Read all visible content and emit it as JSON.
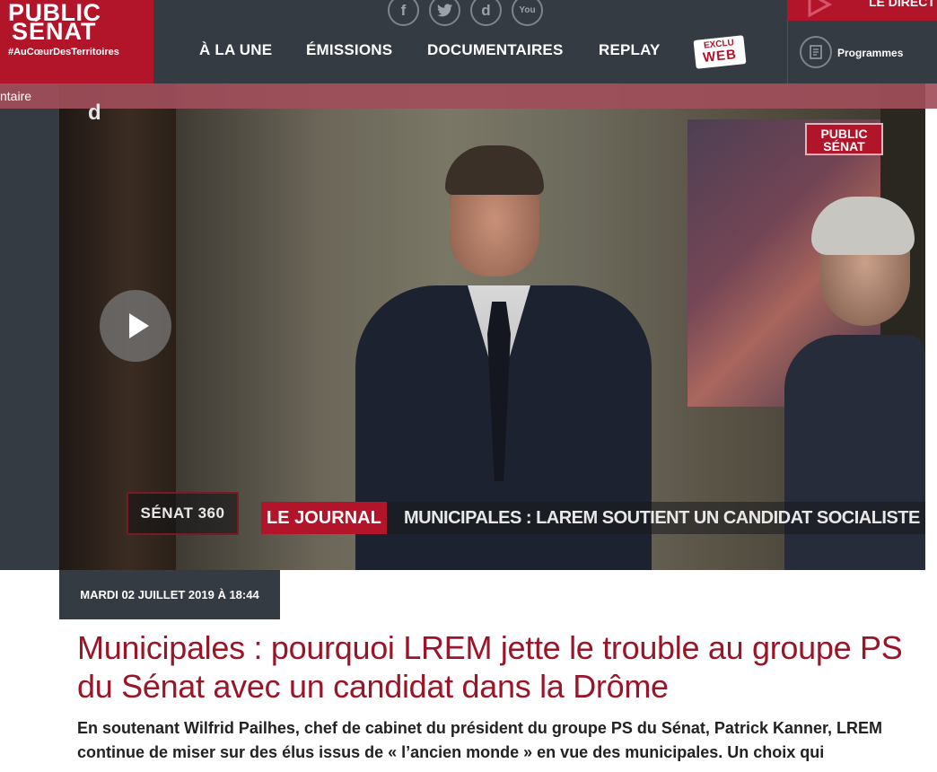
{
  "header": {
    "logo_line1": "PUBLIC",
    "logo_line2": "SÉNAT",
    "logo_tagline": "#AuCœurDesTerritoires",
    "social": [
      {
        "icon": "facebook-icon",
        "glyph": "f"
      },
      {
        "icon": "twitter-icon",
        "glyph": "✦"
      },
      {
        "icon": "dailymotion-icon",
        "glyph": "d"
      },
      {
        "icon": "youtube-icon",
        "glyph": "You"
      }
    ],
    "nav": [
      "À LA UNE",
      "ÉMISSIONS",
      "DOCUMENTAIRES",
      "REPLAY"
    ],
    "exclu_line1": "EXCLU",
    "exclu_line2": "WEB",
    "programmes_label": "Programmes",
    "live_label": "LE DIRECT"
  },
  "strip_text": "ntaire",
  "video": {
    "overlay_letter": "d",
    "channel_logo_line1": "PUBLIC",
    "channel_logo_line2": "SÉNAT",
    "show_badge": "SÉNAT 360",
    "ticker_tag": "LE JOURNAL",
    "ticker_text": "MUNICIPALES : LAREM SOUTIENT UN CANDIDAT SOCIALISTE"
  },
  "article": {
    "date": "MARDI 02 JUILLET 2019 À 18:44",
    "headline": "Municipales : pourquoi LREM jette le trouble au groupe PS du Sénat avec un candidat dans la Drôme",
    "lead": "En soutenant Wilfrid Pailhes, chef de cabinet du président du groupe PS du Sénat, Patrick Kanner, LREM continue de miser sur des élus issus de « l’ancien monde » en vue des municipales. Un choix qui"
  },
  "colors": {
    "brand_red": "#b2142a",
    "header_dark": "#343b43",
    "headline_red": "#9a1527"
  }
}
